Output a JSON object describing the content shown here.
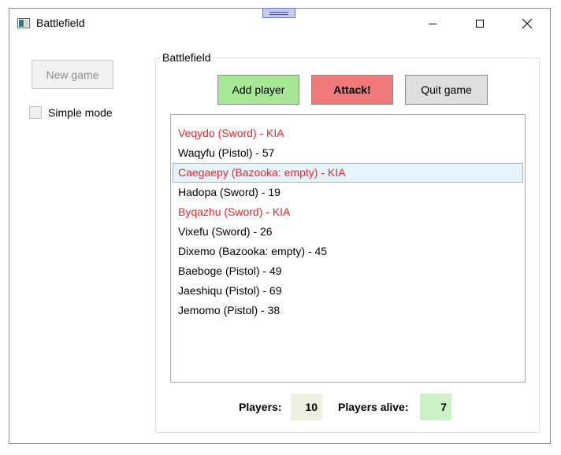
{
  "window": {
    "title": "Battlefield"
  },
  "sidebar": {
    "new_game_label": "New game",
    "simple_mode_label": "Simple mode",
    "simple_mode_checked": false
  },
  "group": {
    "title": "Battlefield"
  },
  "actions": {
    "add_player_label": "Add player",
    "attack_label": "Attack!",
    "quit_label": "Quit game",
    "add_color": "#a6e896",
    "attack_color": "#f07a7a",
    "quit_color": "#dedede"
  },
  "players": [
    {
      "text": "Veqydo (Sword) - KIA",
      "dead": true
    },
    {
      "text": "Waqyfu (Pistol) - 57",
      "dead": false
    },
    {
      "text": "Caegaepy (Bazooka: empty) - KIA",
      "dead": true,
      "selected": true
    },
    {
      "text": "Hadopa (Sword) - 19",
      "dead": false
    },
    {
      "text": "Byqazhu (Sword) - KIA",
      "dead": true
    },
    {
      "text": "Vixefu (Sword) - 26",
      "dead": false
    },
    {
      "text": "Dixemo (Bazooka: empty) - 45",
      "dead": false
    },
    {
      "text": "Baeboge (Pistol) - 49",
      "dead": false
    },
    {
      "text": "Jaeshiqu (Pistol) - 69",
      "dead": false
    },
    {
      "text": "Jemomo (Pistol) - 38",
      "dead": false
    }
  ],
  "stats": {
    "players_label": "Players:",
    "players_value": "10",
    "players_bg": "#eef0e0",
    "alive_label": "Players alive:",
    "alive_value": "7",
    "alive_bg": "#cdf0c8"
  },
  "colors": {
    "kia_text": "#e8262a"
  }
}
